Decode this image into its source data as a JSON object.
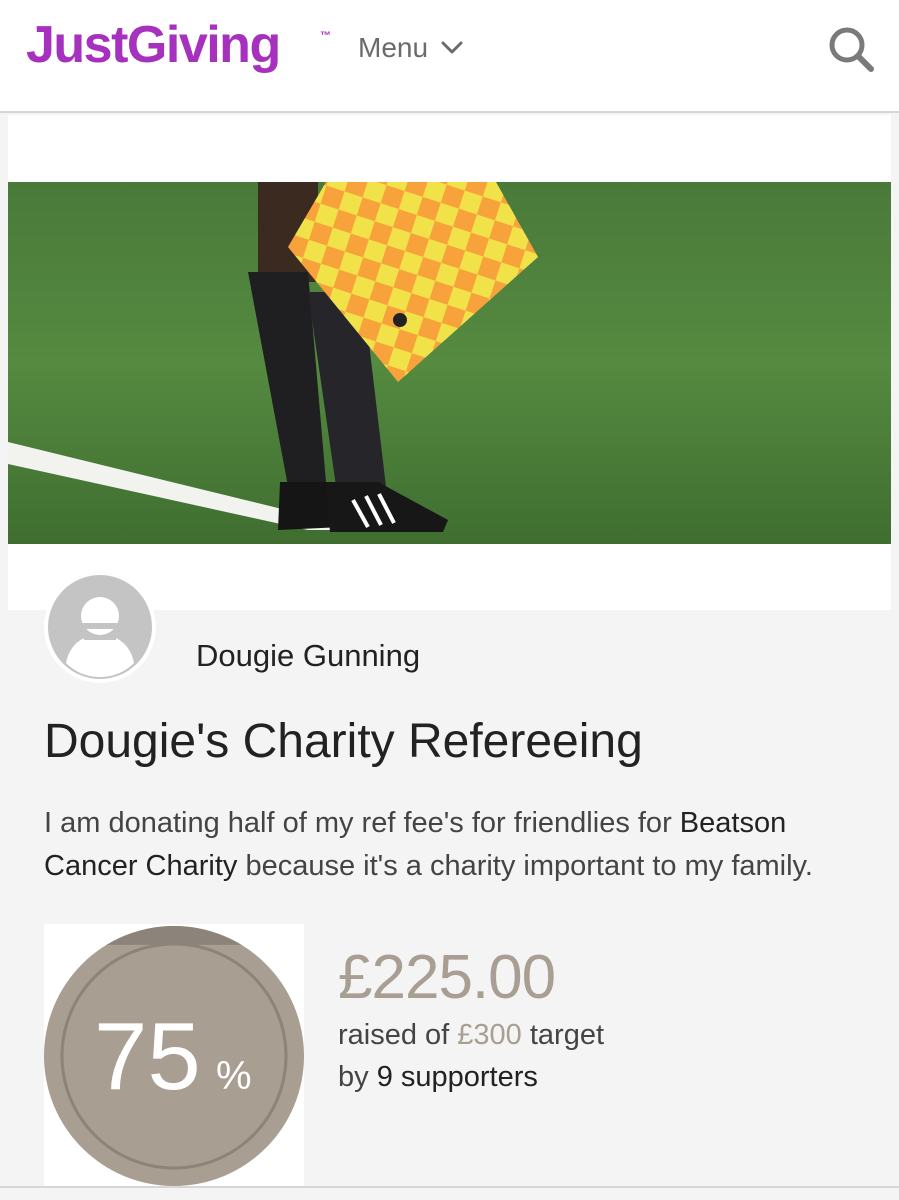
{
  "header": {
    "logo_text": "JustGiving",
    "logo_tm": "™",
    "menu_label": "Menu",
    "menu_icon": "chevron-down-icon",
    "search_icon": "search-icon"
  },
  "organiser": {
    "name": "Dougie Gunning",
    "avatar_icon": "user-placeholder-icon"
  },
  "page": {
    "title": "Dougie's Charity Refereeing",
    "story_before": "I am donating half of my ref fee's for friendlies for ",
    "charity_name": "Beatson Cancer Charity",
    "story_after": " because it's a charity important to my family."
  },
  "progress": {
    "percent_value": "75",
    "percent_sign": "%",
    "percent_fraction": 0.75,
    "raised": "£225.00",
    "raised_prefix": "raised of ",
    "target": "£300",
    "target_suffix": " target",
    "by_prefix": "by ",
    "supporters": "9 supporters"
  },
  "colors": {
    "brand": "#a631be",
    "progress_fill": "#a89e92",
    "progress_dark": "#8c847a",
    "text_muted": "#a89e92"
  }
}
